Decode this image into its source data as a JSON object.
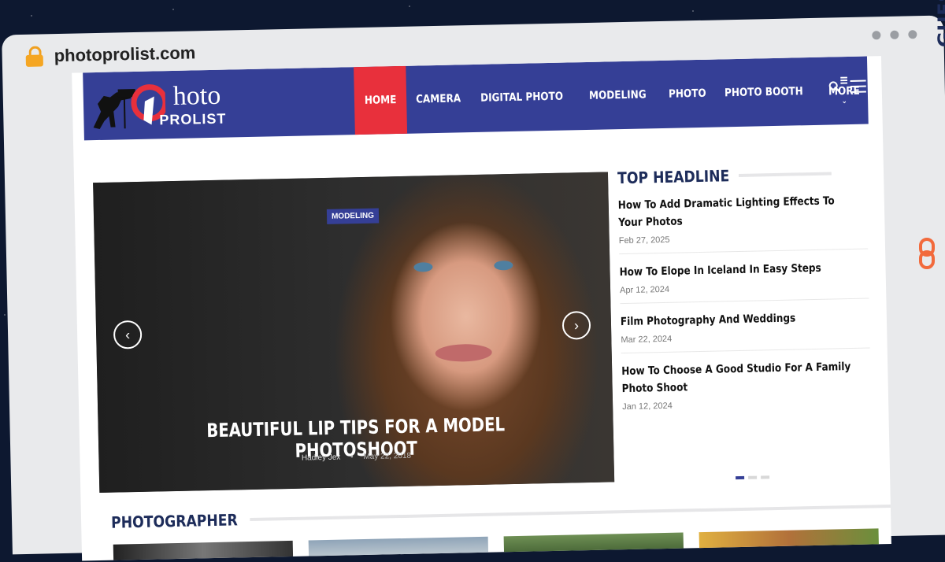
{
  "browser": {
    "domain": "photoprolist.com"
  },
  "brand_watermark": {
    "text": "GUESTPOSTLINKS",
    "color": "#1d2c5a",
    "accent": "#f26a3c"
  },
  "site": {
    "logo": {
      "line1": "hoto",
      "line2": "PROLIST"
    },
    "colors": {
      "nav_bg": "#353f96",
      "active": "#e8303c",
      "heading": "#1d2c5a"
    },
    "nav": [
      {
        "label": "HOME",
        "active": true
      },
      {
        "label": "CAMERA"
      },
      {
        "label": "DIGITAL PHOTO"
      },
      {
        "label": "MODELING"
      },
      {
        "label": "PHOTO"
      },
      {
        "label": "PHOTO BOOTH"
      }
    ],
    "nav_more": "MORE"
  },
  "slider": {
    "tag": "MODELING",
    "title": "BEAUTIFUL LIP TIPS FOR A MODEL PHOTOSHOOT",
    "author": "Hadley Jex",
    "date": "May 22, 2018",
    "prev_icon": "chevron-left-icon",
    "next_icon": "chevron-right-icon"
  },
  "top_headline": {
    "title": "TOP HEADLINE",
    "items": [
      {
        "title": "How To Add Dramatic Lighting Effects To Your Photos",
        "date": "Feb 27, 2025"
      },
      {
        "title": "How To Elope In Iceland In Easy Steps",
        "date": "Apr 12, 2024"
      },
      {
        "title": "Film Photography And Weddings",
        "date": "Mar 22, 2024"
      },
      {
        "title": "How To Choose A Good Studio For A Family Photo Shoot",
        "date": "Jan 12, 2024"
      }
    ],
    "pager_active": 1,
    "pager_count": 3
  },
  "photographer_section": {
    "title": "PHOTOGRAPHER"
  }
}
